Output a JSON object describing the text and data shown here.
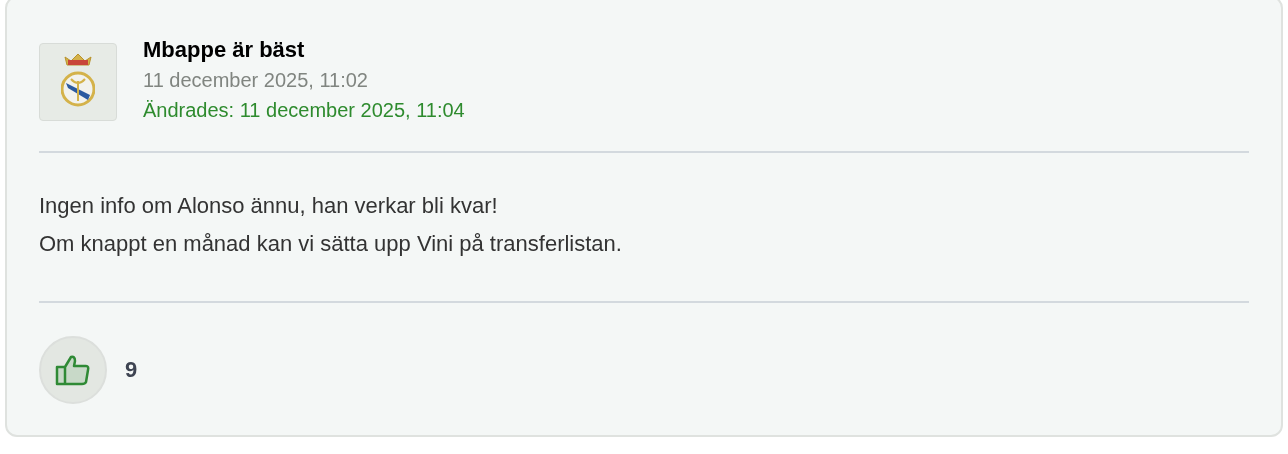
{
  "post": {
    "author": "Mbappe är bäst",
    "posted": "11 december 2025, 11:02",
    "edited": "Ändrades: 11 december 2025, 11:04",
    "body": [
      "Ingen info om Alonso ännu, han verkar bli kvar!",
      "Om knappt en månad kan vi sätta upp Vini på transferlistan."
    ],
    "like": {
      "liked": true,
      "count": "9"
    }
  }
}
